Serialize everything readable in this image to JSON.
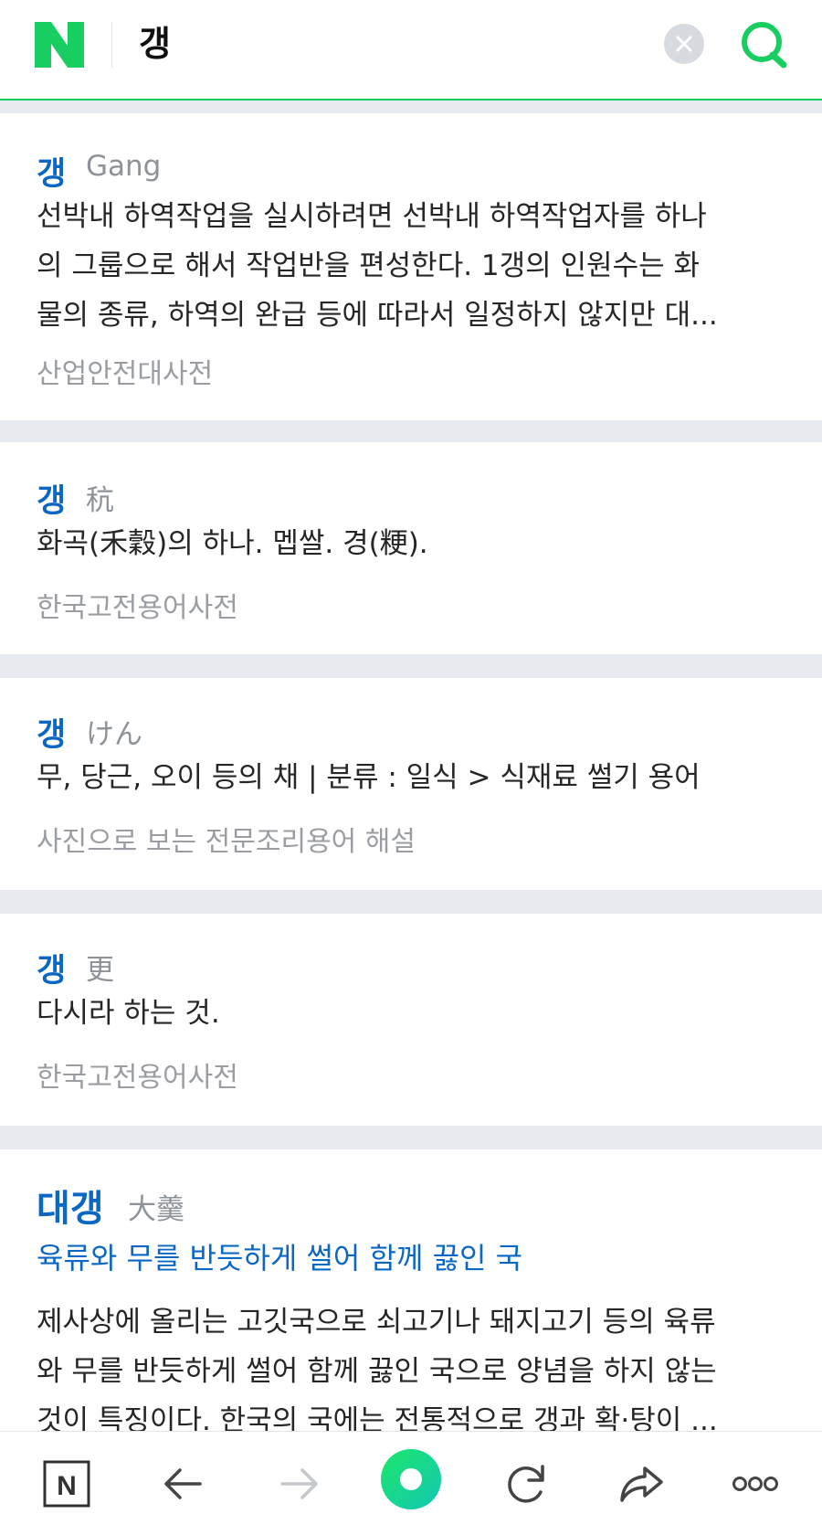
{
  "header": {
    "logo_letter": "N",
    "query": "갱",
    "brand_color": "#19ce60"
  },
  "results": [
    {
      "title": "갱",
      "sub": "Gang",
      "lines": [
        "선박내 하역작업을 실시하려면 선박내 하역작업자를 하나",
        "의 그룹으로 해서 작업반을 편성한다. 1갱의 인원수는 화",
        "물의 종류, 하역의 완급 등에 따라서 일정하지 않지만 대..."
      ],
      "source": "산업안전대사전"
    },
    {
      "title": "갱",
      "sub": "秔",
      "lines": [
        "화곡(禾穀)의 하나. 멥쌀. 경(粳)."
      ],
      "source": "한국고전용어사전"
    },
    {
      "title": "갱",
      "sub": "けん",
      "lines": [
        "무, 당근, 오이 등의 채 | 분류 : 일식 > 식재료 썰기 용어"
      ],
      "source": "사진으로 보는 전문조리용어 해설"
    },
    {
      "title": "갱",
      "sub": "更",
      "lines": [
        "다시라 하는 것."
      ],
      "source": "한국고전용어사전"
    },
    {
      "title": "대갱",
      "sub": "大羹",
      "link": "육류와 무를 반듯하게 썰어 함께 끓인 국",
      "lines": [
        "제사상에 올리는 고깃국으로 쇠고기나 돼지고기 등의 육류",
        "와 무를 반듯하게 썰어 함께 끓인 국으로 양념을 하지 않는",
        "것이 특징이다. 한국의 국에는 전통적으로 갱과 확·탕이 ..."
      ]
    }
  ],
  "bottom_nav": {
    "home_letter": "N",
    "icons": [
      "naver-home-icon",
      "back-arrow-icon",
      "forward-arrow-icon",
      "green-dot-icon",
      "refresh-icon",
      "share-icon",
      "more-icon"
    ]
  }
}
